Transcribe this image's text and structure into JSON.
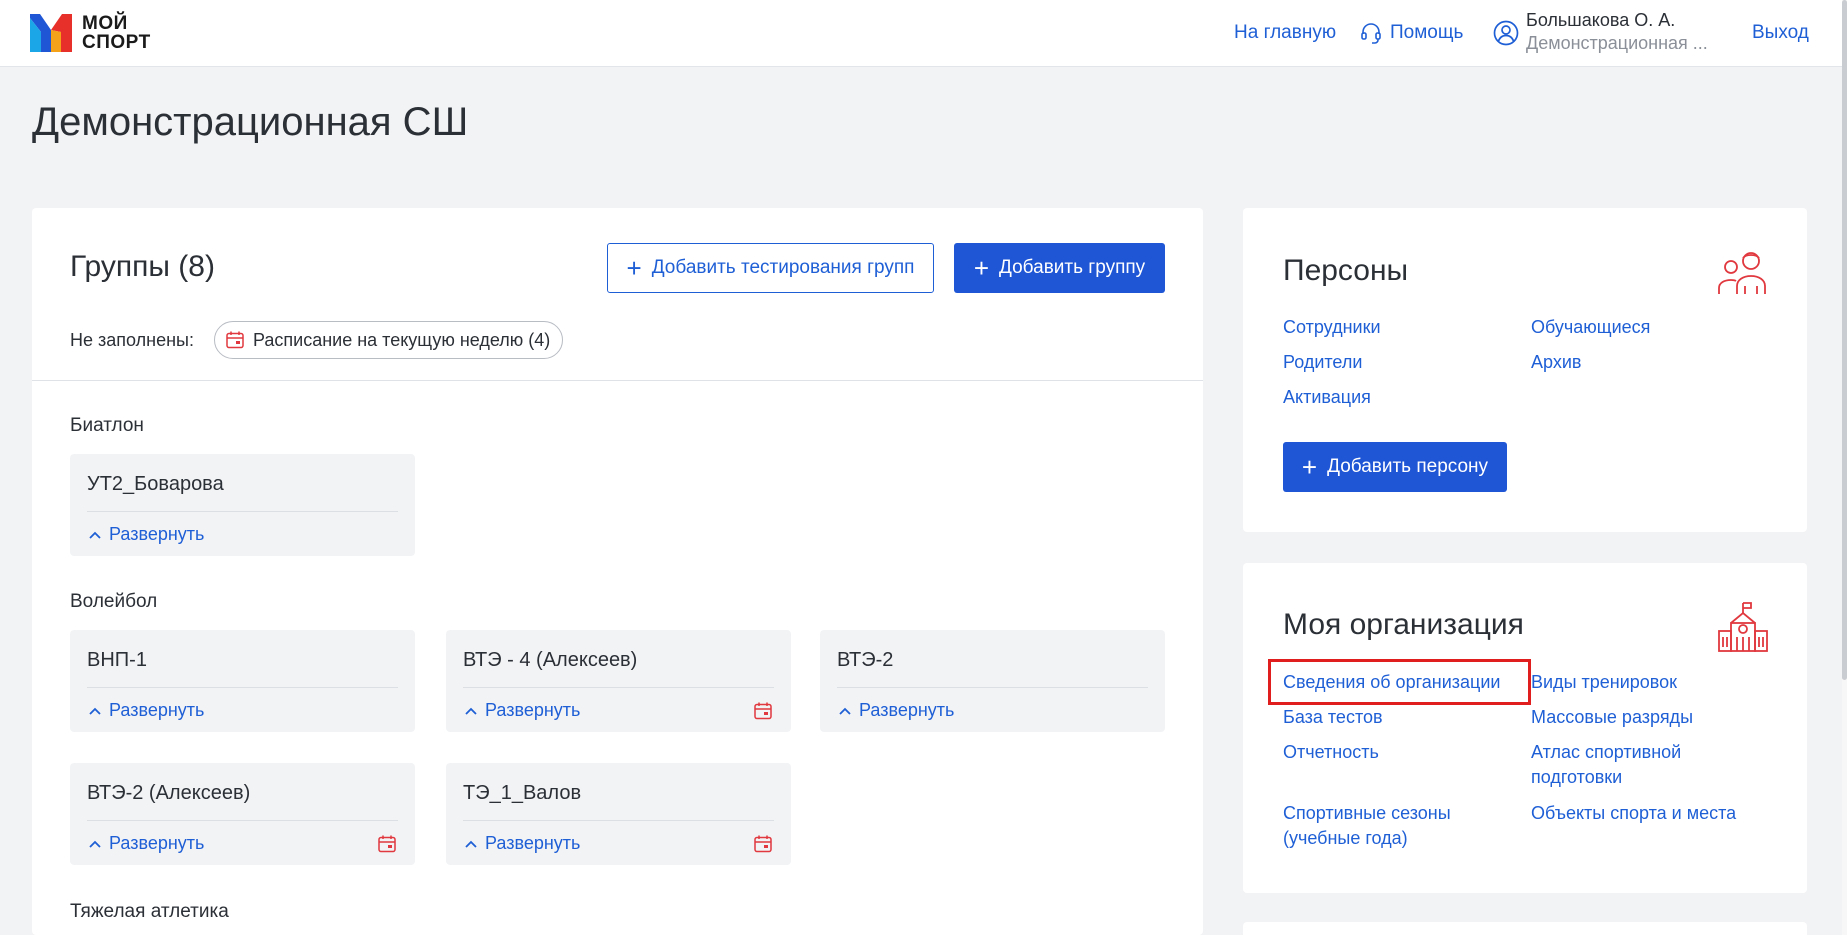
{
  "header": {
    "logo_text_1": "МОЙ",
    "logo_text_2": "СПОРТ",
    "nav_home": "На главную",
    "nav_help": "Помощь",
    "user_name": "Большакова О. А.",
    "user_org": "Демонстрационная ...",
    "logout": "Выход"
  },
  "page": {
    "title": "Демонстрационная СШ"
  },
  "groups": {
    "title": "Группы (8)",
    "add_testing_label": "Добавить тестирования групп",
    "add_group_label": "Добавить группу",
    "unfilled_label": "Не заполнены:",
    "schedule_chip": "Расписание на текущую неделю (4)",
    "expand_label": "Развернуть",
    "sports": [
      {
        "name": "Биатлон",
        "groups": [
          {
            "name": "УТ2_Боварова",
            "has_schedule_icon": false
          }
        ]
      },
      {
        "name": "Волейбол",
        "groups": [
          {
            "name": "ВНП-1",
            "has_schedule_icon": false
          },
          {
            "name": "ВТЭ - 4 (Алексеев)",
            "has_schedule_icon": true
          },
          {
            "name": "ВТЭ-2",
            "has_schedule_icon": false
          },
          {
            "name": "ВТЭ-2 (Алексеев)",
            "has_schedule_icon": true
          },
          {
            "name": "ТЭ_1_Валов",
            "has_schedule_icon": true
          }
        ]
      },
      {
        "name": "Тяжелая атлетика",
        "groups": []
      }
    ]
  },
  "persons": {
    "title": "Персоны",
    "links": [
      "Сотрудники",
      "Обучающиеся",
      "Родители",
      "Архив",
      "Активация"
    ],
    "add_person_label": "Добавить персону"
  },
  "organization": {
    "title": "Моя организация",
    "links": [
      "Сведения об организации",
      "Виды тренировок",
      "База тестов",
      "Массовые разряды",
      "Отчетность",
      "Атлас спортивной подготовки",
      "Спортивные сезоны (учебные года)",
      "Объекты спорта и места"
    ],
    "highlighted_link": "Сведения об организации"
  },
  "colors": {
    "accent": "#1f56d6",
    "link": "#1f5fd6",
    "icon_red": "#e0383e",
    "highlight": "#e01e1e",
    "background": "#f2f3f5"
  }
}
